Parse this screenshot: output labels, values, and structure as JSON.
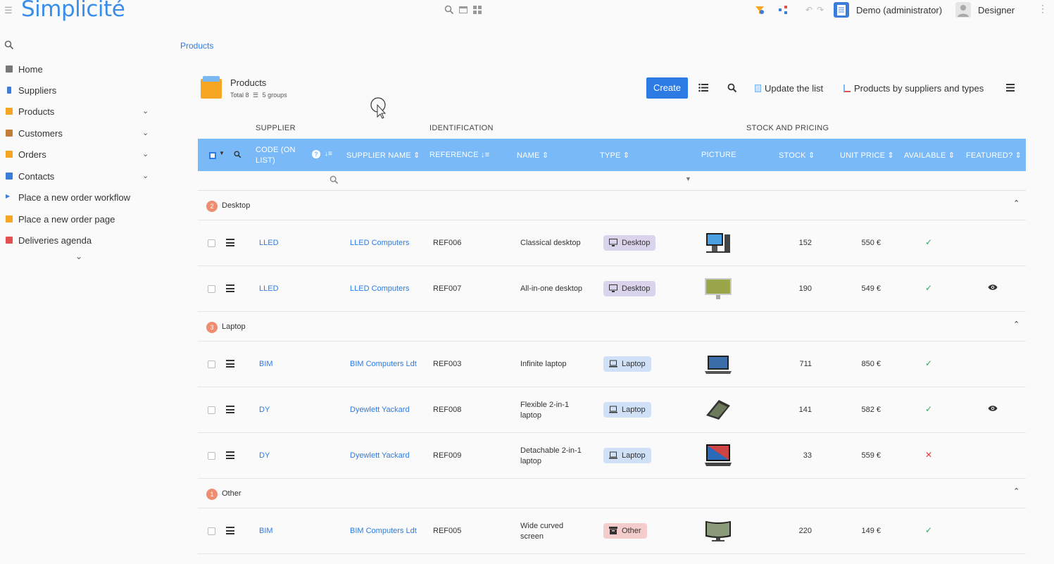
{
  "app": {
    "logo": "Simplicité",
    "user": "Demo (administrator)",
    "designer": "Designer"
  },
  "sidebar": {
    "items": [
      {
        "label": "Home",
        "color": "#777"
      },
      {
        "label": "Suppliers",
        "color": "#3b7dd8"
      },
      {
        "label": "Products",
        "color": "#f6a623"
      },
      {
        "label": "Customers",
        "color": "#c27d3a"
      },
      {
        "label": "Orders",
        "color": "#f6a623"
      },
      {
        "label": "Contacts",
        "color": "#3b7dd8"
      },
      {
        "label": "Place a new order workflow",
        "color": "#3b7dd8"
      },
      {
        "label": "Place a new order page",
        "color": "#f6a623"
      },
      {
        "label": "Deliveries agenda",
        "color": "#e05050"
      }
    ]
  },
  "breadcrumb": "Products",
  "object": {
    "title": "Products",
    "total": "Total 8",
    "groups": "5 groups"
  },
  "toolbar": {
    "create": "Create",
    "update_list": "Update the list",
    "chart": "Products by suppliers and types"
  },
  "column_groups": {
    "supplier": "SUPPLIER",
    "identification": "IDENTIFICATION",
    "stock": "STOCK AND PRICING"
  },
  "columns": {
    "code": "CODE (ON LIST)",
    "supplier_name": "SUPPLIER NAME",
    "reference": "REFERENCE",
    "name": "NAME",
    "type": "TYPE",
    "picture": "PICTURE",
    "stock": "STOCK",
    "unit_price": "UNIT PRICE",
    "available": "AVAILABLE",
    "featured": "FEATURED?"
  },
  "groups": [
    {
      "count": "2",
      "name": "Desktop"
    },
    {
      "count": "3",
      "name": "Laptop"
    },
    {
      "count": "1",
      "name": "Other"
    }
  ],
  "rows": [
    {
      "code": "LLED",
      "supplier": "LLED Computers",
      "ref": "REF006",
      "name": "Classical desktop",
      "type": "Desktop",
      "stock": "152",
      "price": "550 €",
      "available": true,
      "featured": false
    },
    {
      "code": "LLED",
      "supplier": "LLED Computers",
      "ref": "REF007",
      "name": "All-in-one desktop",
      "type": "Desktop",
      "stock": "190",
      "price": "549 €",
      "available": true,
      "featured": true
    },
    {
      "code": "BIM",
      "supplier": "BIM Computers Ldt",
      "ref": "REF003",
      "name": "Infinite laptop",
      "type": "Laptop",
      "stock": "711",
      "price": "850 €",
      "available": true,
      "featured": false
    },
    {
      "code": "DY",
      "supplier": "Dyewlett Yackard",
      "ref": "REF008",
      "name": "Flexible 2-in-1 laptop",
      "type": "Laptop",
      "stock": "141",
      "price": "582 €",
      "available": true,
      "featured": true
    },
    {
      "code": "DY",
      "supplier": "Dyewlett Yackard",
      "ref": "REF009",
      "name": "Detachable 2-in-1 laptop",
      "type": "Laptop",
      "stock": "33",
      "price": "559 €",
      "available": false,
      "featured": false
    },
    {
      "code": "BIM",
      "supplier": "BIM Computers Ldt",
      "ref": "REF005",
      "name": "Wide curved screen",
      "type": "Other",
      "stock": "220",
      "price": "149 €",
      "available": true,
      "featured": false
    }
  ],
  "type_colors": {
    "Desktop": "#d9d4ec",
    "Laptop": "#cfe0f7",
    "Other": "#f5cccc"
  }
}
